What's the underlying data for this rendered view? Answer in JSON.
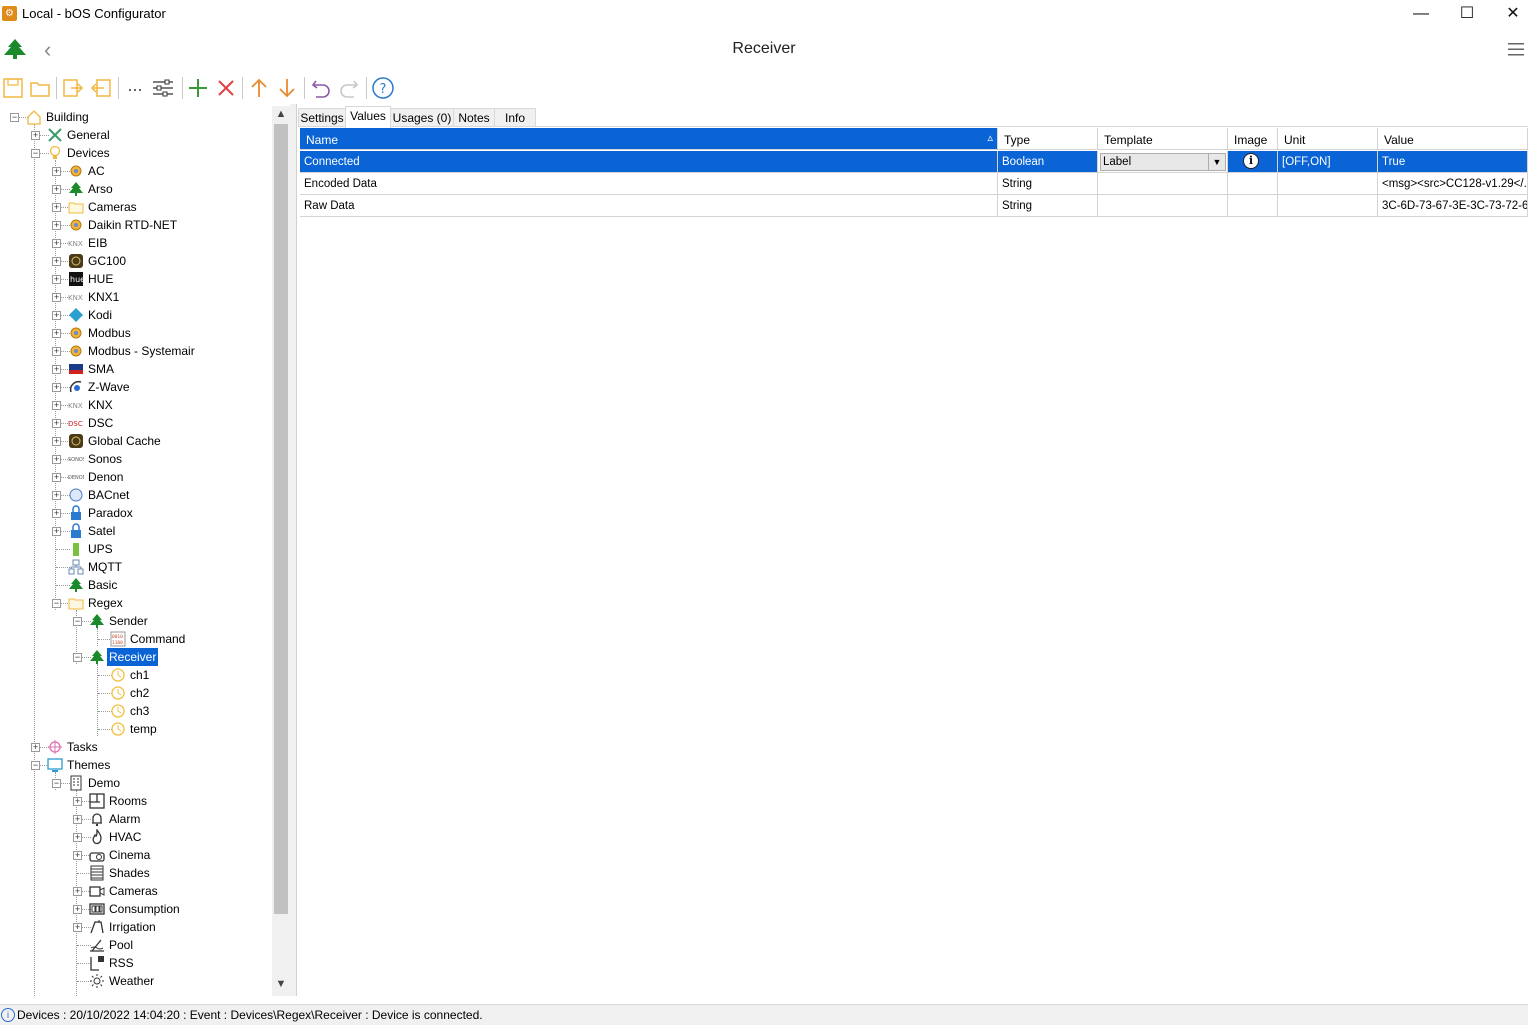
{
  "window": {
    "title": "Local - bOS Configurator",
    "minimize": "—",
    "maximize": "☐",
    "close": "✕"
  },
  "header": {
    "title": "Receiver",
    "back": "‹"
  },
  "tree": {
    "nodes": [
      {
        "label": "Building",
        "icon": "building-icon"
      },
      {
        "label": "General",
        "icon": "tools-icon"
      },
      {
        "label": "Devices",
        "icon": "bulb-icon"
      },
      {
        "label": "AC",
        "icon": "gear-icon"
      },
      {
        "label": "Arso",
        "icon": "tree-icon"
      },
      {
        "label": "Cameras",
        "icon": "folder-icon"
      },
      {
        "label": "Daikin RTD-NET",
        "icon": "gear-icon"
      },
      {
        "label": "EIB",
        "icon": "knx-icon"
      },
      {
        "label": "GC100",
        "icon": "globalcache-icon"
      },
      {
        "label": "HUE",
        "icon": "hue-icon"
      },
      {
        "label": "KNX1",
        "icon": "knx-icon"
      },
      {
        "label": "Kodi",
        "icon": "kodi-icon"
      },
      {
        "label": "Modbus",
        "icon": "gear-icon"
      },
      {
        "label": "Modbus - Systemair",
        "icon": "gear-icon"
      },
      {
        "label": "SMA",
        "icon": "sma-icon"
      },
      {
        "label": "Z-Wave",
        "icon": "zwave-icon"
      },
      {
        "label": "KNX",
        "icon": "knx-icon"
      },
      {
        "label": "DSC",
        "icon": "dsc-icon"
      },
      {
        "label": "Global Cache",
        "icon": "globalcache-icon"
      },
      {
        "label": "Sonos",
        "icon": "sonos-icon"
      },
      {
        "label": "Denon",
        "icon": "denon-icon"
      },
      {
        "label": "BACnet",
        "icon": "bacnet-icon"
      },
      {
        "label": "Paradox",
        "icon": "lock-icon"
      },
      {
        "label": "Satel",
        "icon": "lock-icon"
      },
      {
        "label": "UPS",
        "icon": "battery-icon"
      },
      {
        "label": "MQTT",
        "icon": "network-icon"
      },
      {
        "label": "Basic",
        "icon": "tree-icon"
      },
      {
        "label": "Regex",
        "icon": "folder-icon"
      },
      {
        "label": "Sender",
        "icon": "tree-icon"
      },
      {
        "label": "Command",
        "icon": "command-icon"
      },
      {
        "label": "Receiver",
        "icon": "tree-icon"
      },
      {
        "label": "ch1",
        "icon": "value-icon"
      },
      {
        "label": "ch2",
        "icon": "value-icon"
      },
      {
        "label": "ch3",
        "icon": "value-icon"
      },
      {
        "label": "temp",
        "icon": "value-icon"
      },
      {
        "label": "Tasks",
        "icon": "tasks-icon"
      },
      {
        "label": "Themes",
        "icon": "monitor-icon"
      },
      {
        "label": "Demo",
        "icon": "office-icon"
      },
      {
        "label": "Rooms",
        "icon": "rooms-icon"
      },
      {
        "label": "Alarm",
        "icon": "bell-icon"
      },
      {
        "label": "HVAC",
        "icon": "flame-icon"
      },
      {
        "label": "Cinema",
        "icon": "projector-icon"
      },
      {
        "label": "Shades",
        "icon": "shades-icon"
      },
      {
        "label": "Cameras",
        "icon": "camera-icon"
      },
      {
        "label": "Consumption",
        "icon": "meter-icon"
      },
      {
        "label": "Irrigation",
        "icon": "irrigation-icon"
      },
      {
        "label": "Pool",
        "icon": "pool-icon"
      },
      {
        "label": "RSS",
        "icon": "rss-icon"
      },
      {
        "label": "Weather",
        "icon": "weather-icon"
      }
    ]
  },
  "tabs": [
    {
      "label": "Settings"
    },
    {
      "label": "Values"
    },
    {
      "label": "Usages (0)"
    },
    {
      "label": "Notes"
    },
    {
      "label": "Info"
    }
  ],
  "grid": {
    "columns": [
      "Name",
      "Type",
      "Template",
      "Image",
      "Unit",
      "Value"
    ],
    "sort_indicator": "▵",
    "rows": [
      {
        "name": "Connected",
        "type": "Boolean",
        "template": "Label",
        "image": "info-icon",
        "unit": "[OFF,ON]",
        "value": "True"
      },
      {
        "name": "Encoded Data",
        "type": "String",
        "template": "",
        "image": "",
        "unit": "",
        "value": "<msg><src>CC128-v1.29</..."
      },
      {
        "name": "Raw Data",
        "type": "String",
        "template": "",
        "image": "",
        "unit": "",
        "value": "3C-6D-73-67-3E-3C-73-72-6..."
      }
    ]
  },
  "status": {
    "text": "Devices : 20/10/2022 14:04:20 : Event : Devices\\Regex\\Receiver : Device is connected."
  },
  "colors": {
    "selection": "#0a64d6",
    "accent_orange": "#f0a020",
    "green": "#1a8a2a"
  }
}
